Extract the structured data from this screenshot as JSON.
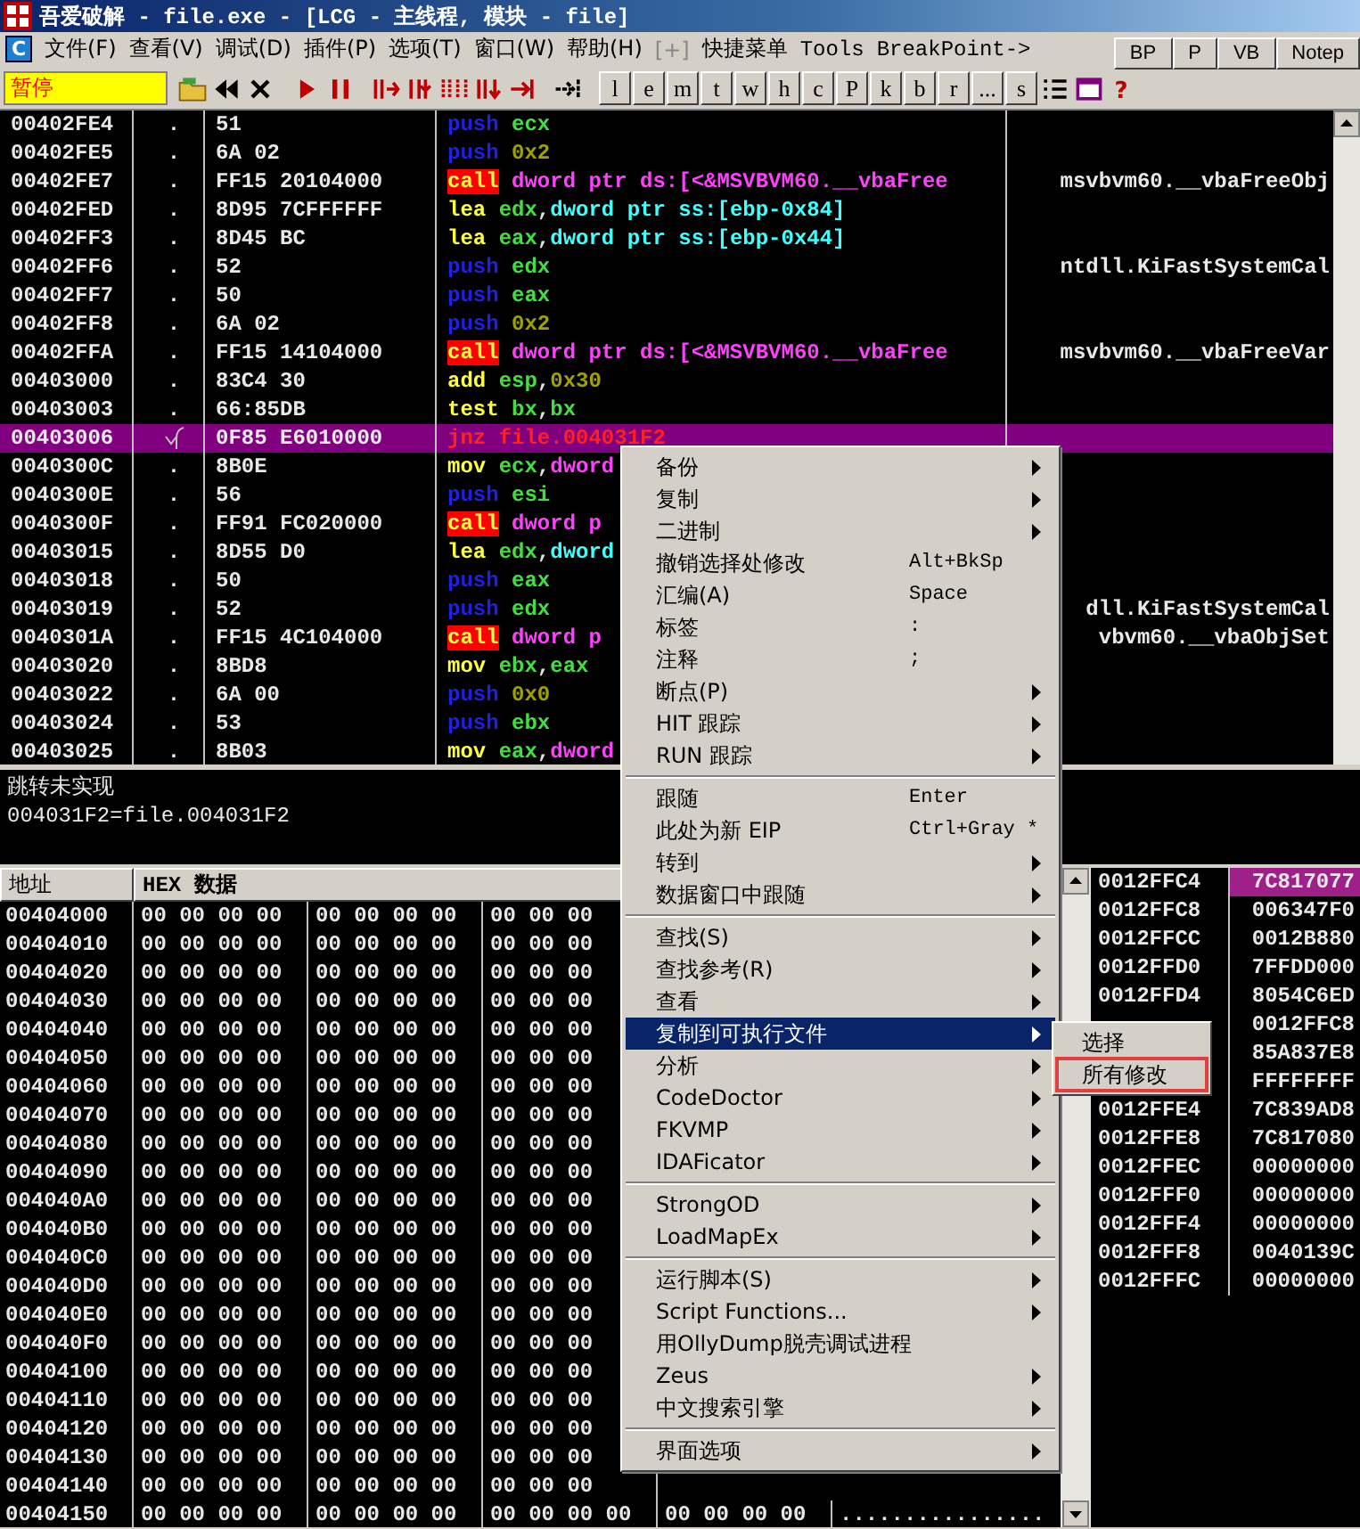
{
  "window": {
    "title": "吾爱破解 - file.exe - [LCG -  主线程, 模块 - file]"
  },
  "menu_bar": {
    "logo": "C",
    "items": [
      {
        "label": "文件(F)",
        "disabled": false
      },
      {
        "label": "查看(V)",
        "disabled": false
      },
      {
        "label": "调试(D)",
        "disabled": false
      },
      {
        "label": "插件(P)",
        "disabled": false
      },
      {
        "label": "选项(T)",
        "disabled": false
      },
      {
        "label": "窗口(W)",
        "disabled": false
      },
      {
        "label": "帮助(H)",
        "disabled": false
      },
      {
        "label": "[+]",
        "disabled": true
      },
      {
        "label": "快捷菜单",
        "disabled": false
      },
      {
        "label": "Tools",
        "disabled": false
      },
      {
        "label": "BreakPoint->",
        "disabled": false
      }
    ]
  },
  "quick_buttons": [
    "BP",
    "P",
    "VB",
    "Notep"
  ],
  "toolbar": {
    "status": "暂停",
    "letters": [
      "l",
      "e",
      "m",
      "t",
      "w",
      "h",
      "c",
      "P",
      "k",
      "b",
      "r",
      "...",
      "s"
    ],
    "help": "?"
  },
  "disassembly": {
    "rows": [
      {
        "address": "00402FE4",
        "marker": ".",
        "hex": "51",
        "mnemonic": {
          "text": "push",
          "kind": "push"
        },
        "operands": [
          {
            "text": "ecx",
            "kind": "reg"
          }
        ],
        "comment": "",
        "selected": false
      },
      {
        "address": "00402FE5",
        "marker": ".",
        "hex": "6A 02",
        "mnemonic": {
          "text": "push",
          "kind": "push"
        },
        "operands": [
          {
            "text": "0x2",
            "kind": "num"
          }
        ],
        "comment": "",
        "selected": false
      },
      {
        "address": "00402FE7",
        "marker": ".",
        "hex": "FF15 20104000",
        "mnemonic": {
          "text": "call",
          "kind": "call"
        },
        "operands": [
          {
            "text": "dword ptr ds:[<&MSVBVM60.__vbaFree",
            "kind": "ptr"
          }
        ],
        "comment": "msvbvm60.__vbaFreeObj",
        "selected": false
      },
      {
        "address": "00402FED",
        "marker": ".",
        "hex": "8D95 7CFFFFFF",
        "mnemonic": {
          "text": "lea",
          "kind": "op"
        },
        "operands": [
          {
            "text": "edx",
            "kind": "reg"
          },
          {
            "text": ",",
            "kind": "sym"
          },
          {
            "text": "dword ptr ss:[ebp-0x84]",
            "kind": "mem"
          }
        ],
        "comment": "",
        "selected": false
      },
      {
        "address": "00402FF3",
        "marker": ".",
        "hex": "8D45 BC",
        "mnemonic": {
          "text": "lea",
          "kind": "op"
        },
        "operands": [
          {
            "text": "eax",
            "kind": "reg"
          },
          {
            "text": ",",
            "kind": "sym"
          },
          {
            "text": "dword ptr ss:[ebp-0x44]",
            "kind": "mem"
          }
        ],
        "comment": "",
        "selected": false
      },
      {
        "address": "00402FF6",
        "marker": ".",
        "hex": "52",
        "mnemonic": {
          "text": "push",
          "kind": "push"
        },
        "operands": [
          {
            "text": "edx",
            "kind": "reg"
          }
        ],
        "comment": "ntdll.KiFastSystemCal",
        "selected": false
      },
      {
        "address": "00402FF7",
        "marker": ".",
        "hex": "50",
        "mnemonic": {
          "text": "push",
          "kind": "push"
        },
        "operands": [
          {
            "text": "eax",
            "kind": "reg"
          }
        ],
        "comment": "",
        "selected": false
      },
      {
        "address": "00402FF8",
        "marker": ".",
        "hex": "6A 02",
        "mnemonic": {
          "text": "push",
          "kind": "push"
        },
        "operands": [
          {
            "text": "0x2",
            "kind": "num"
          }
        ],
        "comment": "",
        "selected": false
      },
      {
        "address": "00402FFA",
        "marker": ".",
        "hex": "FF15 14104000",
        "mnemonic": {
          "text": "call",
          "kind": "call"
        },
        "operands": [
          {
            "text": "dword ptr ds:[<&MSVBVM60.__vbaFree",
            "kind": "ptr"
          }
        ],
        "comment": "msvbvm60.__vbaFreeVar",
        "selected": false
      },
      {
        "address": "00403000",
        "marker": ".",
        "hex": "83C4 30",
        "mnemonic": {
          "text": "add",
          "kind": "op"
        },
        "operands": [
          {
            "text": "esp",
            "kind": "reg"
          },
          {
            "text": ",",
            "kind": "sym"
          },
          {
            "text": "0x30",
            "kind": "num"
          }
        ],
        "comment": "",
        "selected": false
      },
      {
        "address": "00403003",
        "marker": ".",
        "hex": "66:85DB",
        "mnemonic": {
          "text": "test",
          "kind": "op"
        },
        "operands": [
          {
            "text": "bx",
            "kind": "reg"
          },
          {
            "text": ",",
            "kind": "sym"
          },
          {
            "text": "bx",
            "kind": "reg"
          }
        ],
        "comment": "",
        "selected": false
      },
      {
        "address": "00403006",
        "jump": true,
        "hex": "0F85 E6010000",
        "mnemonic": {
          "text": "jnz",
          "kind": "jump"
        },
        "operands": [
          {
            "text": "file.004031F2",
            "kind": "jump"
          }
        ],
        "comment": "",
        "selected": true
      },
      {
        "address": "0040300C",
        "marker": ".",
        "hex": "8B0E",
        "mnemonic": {
          "text": "mov",
          "kind": "op"
        },
        "operands": [
          {
            "text": "ecx",
            "kind": "reg"
          },
          {
            "text": ",",
            "kind": "sym"
          },
          {
            "text": "dword",
            "kind": "ptr"
          }
        ],
        "comment": "",
        "selected": false
      },
      {
        "address": "0040300E",
        "marker": ".",
        "hex": "56",
        "mnemonic": {
          "text": "push",
          "kind": "push"
        },
        "operands": [
          {
            "text": "esi",
            "kind": "reg"
          }
        ],
        "comment": "",
        "selected": false
      },
      {
        "address": "0040300F",
        "marker": ".",
        "hex": "FF91 FC020000",
        "mnemonic": {
          "text": "call",
          "kind": "call"
        },
        "operands": [
          {
            "text": "dword p",
            "kind": "ptr"
          }
        ],
        "comment": "",
        "selected": false
      },
      {
        "address": "00403015",
        "marker": ".",
        "hex": "8D55 D0",
        "mnemonic": {
          "text": "lea",
          "kind": "op"
        },
        "operands": [
          {
            "text": "edx",
            "kind": "reg"
          },
          {
            "text": ",",
            "kind": "sym"
          },
          {
            "text": "dword",
            "kind": "mem"
          }
        ],
        "comment": "",
        "selected": false
      },
      {
        "address": "00403018",
        "marker": ".",
        "hex": "50",
        "mnemonic": {
          "text": "push",
          "kind": "push"
        },
        "operands": [
          {
            "text": "eax",
            "kind": "reg"
          }
        ],
        "comment": "",
        "selected": false
      },
      {
        "address": "00403019",
        "marker": ".",
        "hex": "52",
        "mnemonic": {
          "text": "push",
          "kind": "push"
        },
        "operands": [
          {
            "text": "edx",
            "kind": "reg"
          }
        ],
        "comment": "dll.KiFastSystemCal",
        "selected": false
      },
      {
        "address": "0040301A",
        "marker": ".",
        "hex": "FF15 4C104000",
        "mnemonic": {
          "text": "call",
          "kind": "call"
        },
        "operands": [
          {
            "text": "dword p",
            "kind": "ptr"
          }
        ],
        "comment": "vbvm60.__vbaObjSet",
        "selected": false
      },
      {
        "address": "00403020",
        "marker": ".",
        "hex": "8BD8",
        "mnemonic": {
          "text": "mov",
          "kind": "op"
        },
        "operands": [
          {
            "text": "ebx",
            "kind": "reg"
          },
          {
            "text": ",",
            "kind": "sym"
          },
          {
            "text": "eax",
            "kind": "reg"
          }
        ],
        "comment": "",
        "selected": false
      },
      {
        "address": "00403022",
        "marker": ".",
        "hex": "6A 00",
        "mnemonic": {
          "text": "push",
          "kind": "push"
        },
        "operands": [
          {
            "text": "0x0",
            "kind": "num"
          }
        ],
        "comment": "",
        "selected": false
      },
      {
        "address": "00403024",
        "marker": ".",
        "hex": "53",
        "mnemonic": {
          "text": "push",
          "kind": "push"
        },
        "operands": [
          {
            "text": "ebx",
            "kind": "reg"
          }
        ],
        "comment": "",
        "selected": false
      },
      {
        "address": "00403025",
        "marker": ".",
        "hex": "8B03",
        "mnemonic": {
          "text": "mov",
          "kind": "op"
        },
        "operands": [
          {
            "text": "eax",
            "kind": "reg"
          },
          {
            "text": ",",
            "kind": "sym"
          },
          {
            "text": "dword",
            "kind": "ptr"
          }
        ],
        "comment": "",
        "selected": false
      }
    ]
  },
  "info": {
    "lines": [
      "跳转未实现",
      "004031F2=file.004031F2"
    ]
  },
  "dump": {
    "columns": [
      "地址",
      "HEX 数据"
    ],
    "rows": [
      {
        "address": "00404000",
        "groups": [
          "00 00 00 00",
          "00 00 00 00",
          "00 00 00"
        ]
      },
      {
        "address": "00404010",
        "groups": [
          "00 00 00 00",
          "00 00 00 00",
          "00 00 00"
        ]
      },
      {
        "address": "00404020",
        "groups": [
          "00 00 00 00",
          "00 00 00 00",
          "00 00 00"
        ]
      },
      {
        "address": "00404030",
        "groups": [
          "00 00 00 00",
          "00 00 00 00",
          "00 00 00"
        ]
      },
      {
        "address": "00404040",
        "groups": [
          "00 00 00 00",
          "00 00 00 00",
          "00 00 00"
        ]
      },
      {
        "address": "00404050",
        "groups": [
          "00 00 00 00",
          "00 00 00 00",
          "00 00 00"
        ]
      },
      {
        "address": "00404060",
        "groups": [
          "00 00 00 00",
          "00 00 00 00",
          "00 00 00"
        ]
      },
      {
        "address": "00404070",
        "groups": [
          "00 00 00 00",
          "00 00 00 00",
          "00 00 00"
        ]
      },
      {
        "address": "00404080",
        "groups": [
          "00 00 00 00",
          "00 00 00 00",
          "00 00 00"
        ]
      },
      {
        "address": "00404090",
        "groups": [
          "00 00 00 00",
          "00 00 00 00",
          "00 00 00"
        ]
      },
      {
        "address": "004040A0",
        "groups": [
          "00 00 00 00",
          "00 00 00 00",
          "00 00 00"
        ]
      },
      {
        "address": "004040B0",
        "groups": [
          "00 00 00 00",
          "00 00 00 00",
          "00 00 00"
        ]
      },
      {
        "address": "004040C0",
        "groups": [
          "00 00 00 00",
          "00 00 00 00",
          "00 00 00"
        ]
      },
      {
        "address": "004040D0",
        "groups": [
          "00 00 00 00",
          "00 00 00 00",
          "00 00 00"
        ]
      },
      {
        "address": "004040E0",
        "groups": [
          "00 00 00 00",
          "00 00 00 00",
          "00 00 00"
        ]
      },
      {
        "address": "004040F0",
        "groups": [
          "00 00 00 00",
          "00 00 00 00",
          "00 00 00"
        ]
      },
      {
        "address": "00404100",
        "groups": [
          "00 00 00 00",
          "00 00 00 00",
          "00 00 00"
        ]
      },
      {
        "address": "00404110",
        "groups": [
          "00 00 00 00",
          "00 00 00 00",
          "00 00 00"
        ]
      },
      {
        "address": "00404120",
        "groups": [
          "00 00 00 00",
          "00 00 00 00",
          "00 00 00"
        ]
      },
      {
        "address": "00404130",
        "groups": [
          "00 00 00 00",
          "00 00 00 00",
          "00 00 00"
        ]
      },
      {
        "address": "00404140",
        "groups": [
          "00 00 00 00",
          "00 00 00 00",
          "00 00 00"
        ]
      },
      {
        "address": "00404150",
        "groups": [
          "00 00 00 00",
          "00 00 00 00",
          "00 00 00 00",
          "00 00 00 00"
        ],
        "ascii": "................"
      }
    ]
  },
  "stack": {
    "rows": [
      {
        "address": "0012FFC4",
        "value": "7C817077",
        "selected": true
      },
      {
        "address": "0012FFC8",
        "value": "006347F0",
        "selected": false
      },
      {
        "address": "0012FFCC",
        "value": "0012B880",
        "selected": false
      },
      {
        "address": "0012FFD0",
        "value": "7FFDD000",
        "selected": false
      },
      {
        "address": "0012FFD4",
        "value": "8054C6ED",
        "selected": false
      },
      {
        "value": "0012FFC8",
        "selected": false
      },
      {
        "value": "85A837E8",
        "selected": false
      },
      {
        "value": "FFFFFFFF",
        "selected": false
      },
      {
        "address": "0012FFE4",
        "value": "7C839AD8",
        "selected": false
      },
      {
        "address": "0012FFE8",
        "value": "7C817080",
        "selected": false
      },
      {
        "address": "0012FFEC",
        "value": "00000000",
        "selected": false
      },
      {
        "address": "0012FFF0",
        "value": "00000000",
        "selected": false
      },
      {
        "address": "0012FFF4",
        "value": "00000000",
        "selected": false
      },
      {
        "address": "0012FFF8",
        "value": "0040139C",
        "selected": false
      },
      {
        "address": "0012FFFC",
        "value": "00000000",
        "selected": false
      }
    ]
  },
  "context_menu": {
    "items": [
      {
        "kind": "item",
        "label": "备份",
        "submenu": true,
        "selected": false
      },
      {
        "kind": "item",
        "label": "复制",
        "submenu": true,
        "selected": false
      },
      {
        "kind": "item",
        "label": "二进制",
        "submenu": true,
        "selected": false
      },
      {
        "kind": "item",
        "label": "撤销选择处修改",
        "shortcut": "Alt+BkSp",
        "submenu": false,
        "selected": false
      },
      {
        "kind": "item",
        "label": "汇编(A)",
        "shortcut": "Space",
        "submenu": false,
        "selected": false
      },
      {
        "kind": "item",
        "label": "标签",
        "shortcut": ":",
        "submenu": false,
        "selected": false
      },
      {
        "kind": "item",
        "label": "注释",
        "shortcut": ";",
        "submenu": false,
        "selected": false
      },
      {
        "kind": "item",
        "label": "断点(P)",
        "submenu": true,
        "selected": false
      },
      {
        "kind": "item",
        "label": "HIT 跟踪",
        "submenu": true,
        "selected": false
      },
      {
        "kind": "item",
        "label": "RUN 跟踪",
        "submenu": true,
        "selected": false
      },
      {
        "kind": "separator"
      },
      {
        "kind": "item",
        "label": "跟随",
        "shortcut": "Enter",
        "submenu": false,
        "selected": false
      },
      {
        "kind": "item",
        "label": "此处为新 EIP",
        "shortcut": "Ctrl+Gray *",
        "submenu": false,
        "selected": false
      },
      {
        "kind": "item",
        "label": "转到",
        "submenu": true,
        "selected": false
      },
      {
        "kind": "item",
        "label": "数据窗口中跟随",
        "submenu": true,
        "selected": false
      },
      {
        "kind": "separator"
      },
      {
        "kind": "item",
        "label": "查找(S)",
        "submenu": true,
        "selected": false
      },
      {
        "kind": "item",
        "label": "查找参考(R)",
        "submenu": true,
        "selected": false
      },
      {
        "kind": "item",
        "label": "查看",
        "submenu": true,
        "selected": false
      },
      {
        "kind": "item",
        "label": "复制到可执行文件",
        "submenu": true,
        "selected": true
      },
      {
        "kind": "item",
        "label": "分析",
        "submenu": true,
        "selected": false
      },
      {
        "kind": "item",
        "label": "CodeDoctor",
        "submenu": true,
        "selected": false
      },
      {
        "kind": "item",
        "label": "FKVMP",
        "submenu": true,
        "selected": false
      },
      {
        "kind": "item",
        "label": "IDAFicator",
        "submenu": true,
        "selected": false
      },
      {
        "kind": "separator"
      },
      {
        "kind": "item",
        "label": "StrongOD",
        "submenu": true,
        "selected": false
      },
      {
        "kind": "item",
        "label": "LoadMapEx",
        "submenu": true,
        "selected": false
      },
      {
        "kind": "separator"
      },
      {
        "kind": "item",
        "label": "运行脚本(S)",
        "submenu": true,
        "selected": false
      },
      {
        "kind": "item",
        "label": "Script Functions...",
        "submenu": true,
        "selected": false
      },
      {
        "kind": "item",
        "label": "用OllyDump脱壳调试进程",
        "submenu": false,
        "selected": false
      },
      {
        "kind": "item",
        "label": "Zeus",
        "submenu": true,
        "selected": false
      },
      {
        "kind": "item",
        "label": "中文搜索引擎",
        "submenu": true,
        "selected": false
      },
      {
        "kind": "separator"
      },
      {
        "kind": "item",
        "label": "界面选项",
        "submenu": true,
        "selected": false
      }
    ]
  },
  "submenu": {
    "items": [
      {
        "label": "选择",
        "highlighted": false
      },
      {
        "label": "所有修改",
        "highlighted": true
      }
    ]
  }
}
